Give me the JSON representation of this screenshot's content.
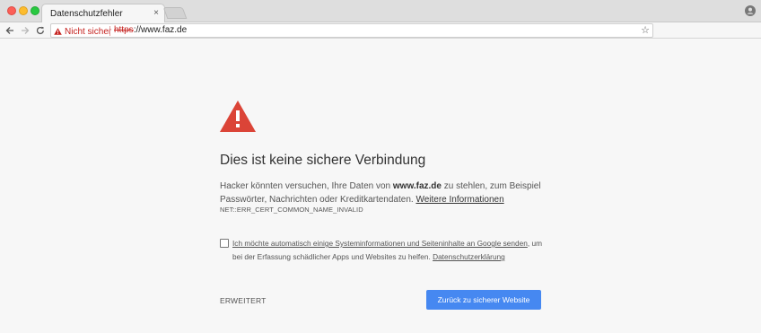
{
  "tab": {
    "title": "Datenschutzfehler",
    "close_label": "×"
  },
  "omnibox": {
    "security_label": "Nicht sicher",
    "url_scheme": "https",
    "url_rest": "://www.faz.de",
    "star_label": "☆"
  },
  "interstitial": {
    "heading": "Dies ist keine sichere Verbindung",
    "para_pre": "Hacker könnten versuchen, Ihre Daten von ",
    "para_domain": "www.faz.de",
    "para_post": " zu stehlen, zum Beispiel Passwörter, Nachrichten oder Kreditkartendaten. ",
    "learn_more_link": "Weitere Informationen",
    "error_code": "NET::ERR_CERT_COMMON_NAME_INVALID",
    "optin_link": "Ich möchte automatisch einige Systeminformationen und Seiteninhalte an Google senden",
    "optin_text": ", um bei der Erfassung schädlicher Apps und Websites zu helfen. ",
    "privacy_link": "Datenschutzerklärung",
    "advanced_button": "ERWEITERT",
    "back_button": "Zurück zu sicherer Website"
  },
  "colors": {
    "warning_red": "#db4437",
    "primary_blue": "#4688f1",
    "insecure_red": "#c5221f"
  }
}
